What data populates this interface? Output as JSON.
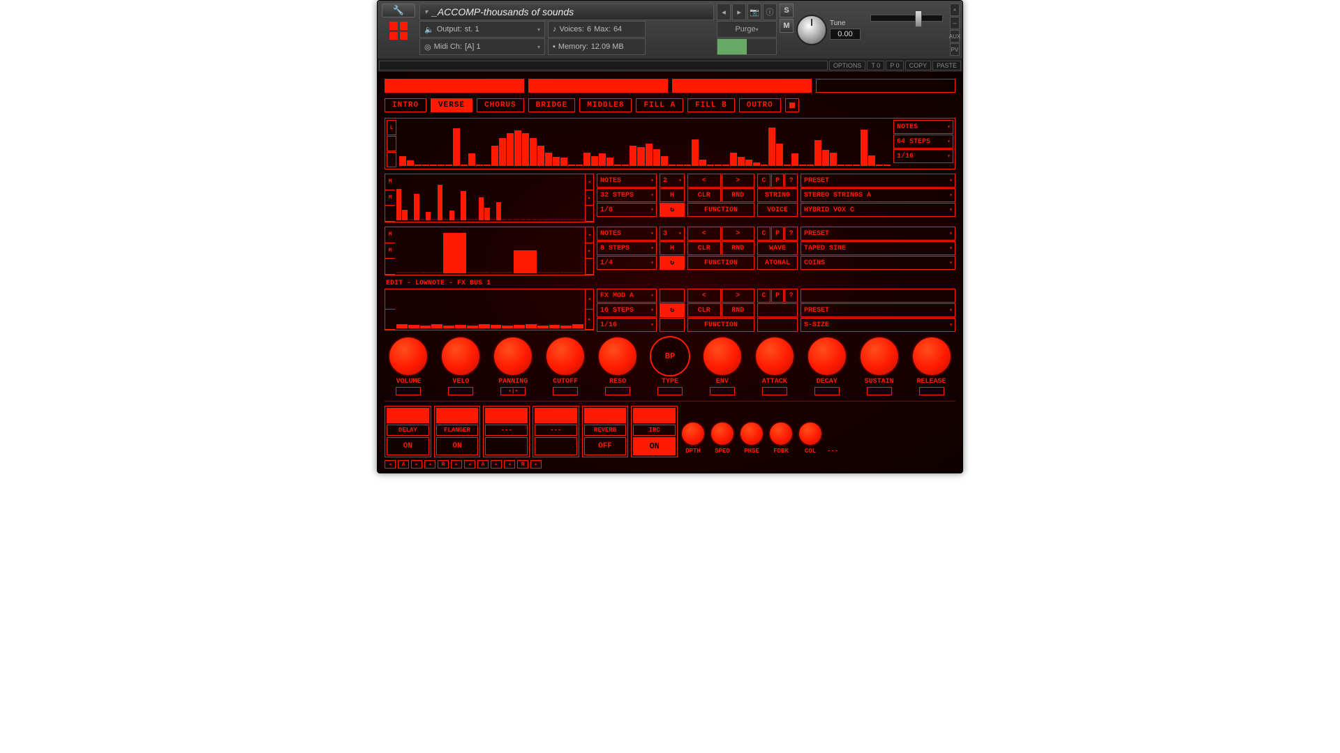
{
  "header": {
    "instrument": "_ACCOMP-thousands of sounds",
    "output_label": "Output:",
    "output": "st. 1",
    "voices_label": "Voices:",
    "voices_cur": "6",
    "voices_max_label": "Max:",
    "voices_max": "64",
    "purge": "Purge",
    "midi_label": "Midi Ch:",
    "midi": "[A] 1",
    "memory_label": "Memory:",
    "memory": "12.09 MB",
    "solo": "S",
    "mute": "M",
    "tune_label": "Tune",
    "tune_value": "0.00",
    "close": "×",
    "min": "–",
    "aux": "AUX",
    "pv": "PV"
  },
  "subheader": {
    "options": "OPTIONS",
    "t0": "T 0",
    "p0": "P 0",
    "copy": "COPY",
    "paste": "PASTE"
  },
  "tabs": [
    "INTRO",
    "VERSE",
    "CHORUS",
    "BRIDGE",
    "MIDDLE8",
    "FILL A",
    "FILL B",
    "OUTRO"
  ],
  "tabs_active": 1,
  "seq_right": {
    "notes": "NOTES",
    "steps": "64 STEPS",
    "div": "1/16"
  },
  "mid_block_a": {
    "notes": "NOTES",
    "steps": "32 STEPS",
    "div": "1/8",
    "num": "2",
    "h": "H",
    "clr": "CLR",
    "rnd": "RND",
    "function": "FUNCTION",
    "cpr": [
      "C",
      "P",
      "?"
    ],
    "row1_lbl": "PRESET",
    "row2_lbl": "STRING",
    "row3_lbl": "VOICE",
    "row2_val": "STEREO STRINGS A",
    "row3_val": "HYBRID VOX C"
  },
  "mid_block_b": {
    "notes": "NOTES",
    "steps": "8 STEPS",
    "div": "1/4",
    "num": "3",
    "h": "H",
    "clr": "CLR",
    "rnd": "RND",
    "function": "FUNCTION",
    "cpr": [
      "C",
      "P",
      "?"
    ],
    "row1_lbl": "PRESET",
    "row2_lbl": "WAVE",
    "row3_lbl": "ATONAL",
    "row2_val": "TAPED SINE",
    "row3_val": "COINS"
  },
  "edit_label": "EDIT - LOWNOTE - FX BUS 1",
  "fxmod_block": {
    "fxmod": "FX MOD A",
    "steps": "16 STEPS",
    "div": "1/16",
    "clr": "CLR",
    "rnd": "RND",
    "function": "FUNCTION",
    "cpr": [
      "C",
      "P",
      "?"
    ],
    "preset": "PRESET",
    "size": "S-SIZE"
  },
  "knobs": [
    "VOLUME",
    "VELO",
    "PANNING",
    "CUTOFF",
    "RESO",
    "TYPE",
    "ENV",
    "ATTACK",
    "DECAY",
    "SUSTAIN",
    "RELEASE"
  ],
  "fx_slots": [
    {
      "name": "DELAY",
      "state": "ON"
    },
    {
      "name": "FLANGER",
      "state": "ON"
    },
    {
      "name": "---",
      "state": ""
    },
    {
      "name": "---",
      "state": ""
    },
    {
      "name": "REVERB",
      "state": "OFF"
    },
    {
      "name": "IRC",
      "state": "ON",
      "big": true
    }
  ],
  "fx_knobs": [
    "DPTH",
    "SPED",
    "PHSE",
    "FDBK",
    "COL"
  ],
  "nav_chars": [
    "◂",
    "A",
    "▸",
    "◂",
    "R",
    "▸",
    "◂",
    "A",
    "▸",
    "◂",
    "R",
    "▸"
  ]
}
